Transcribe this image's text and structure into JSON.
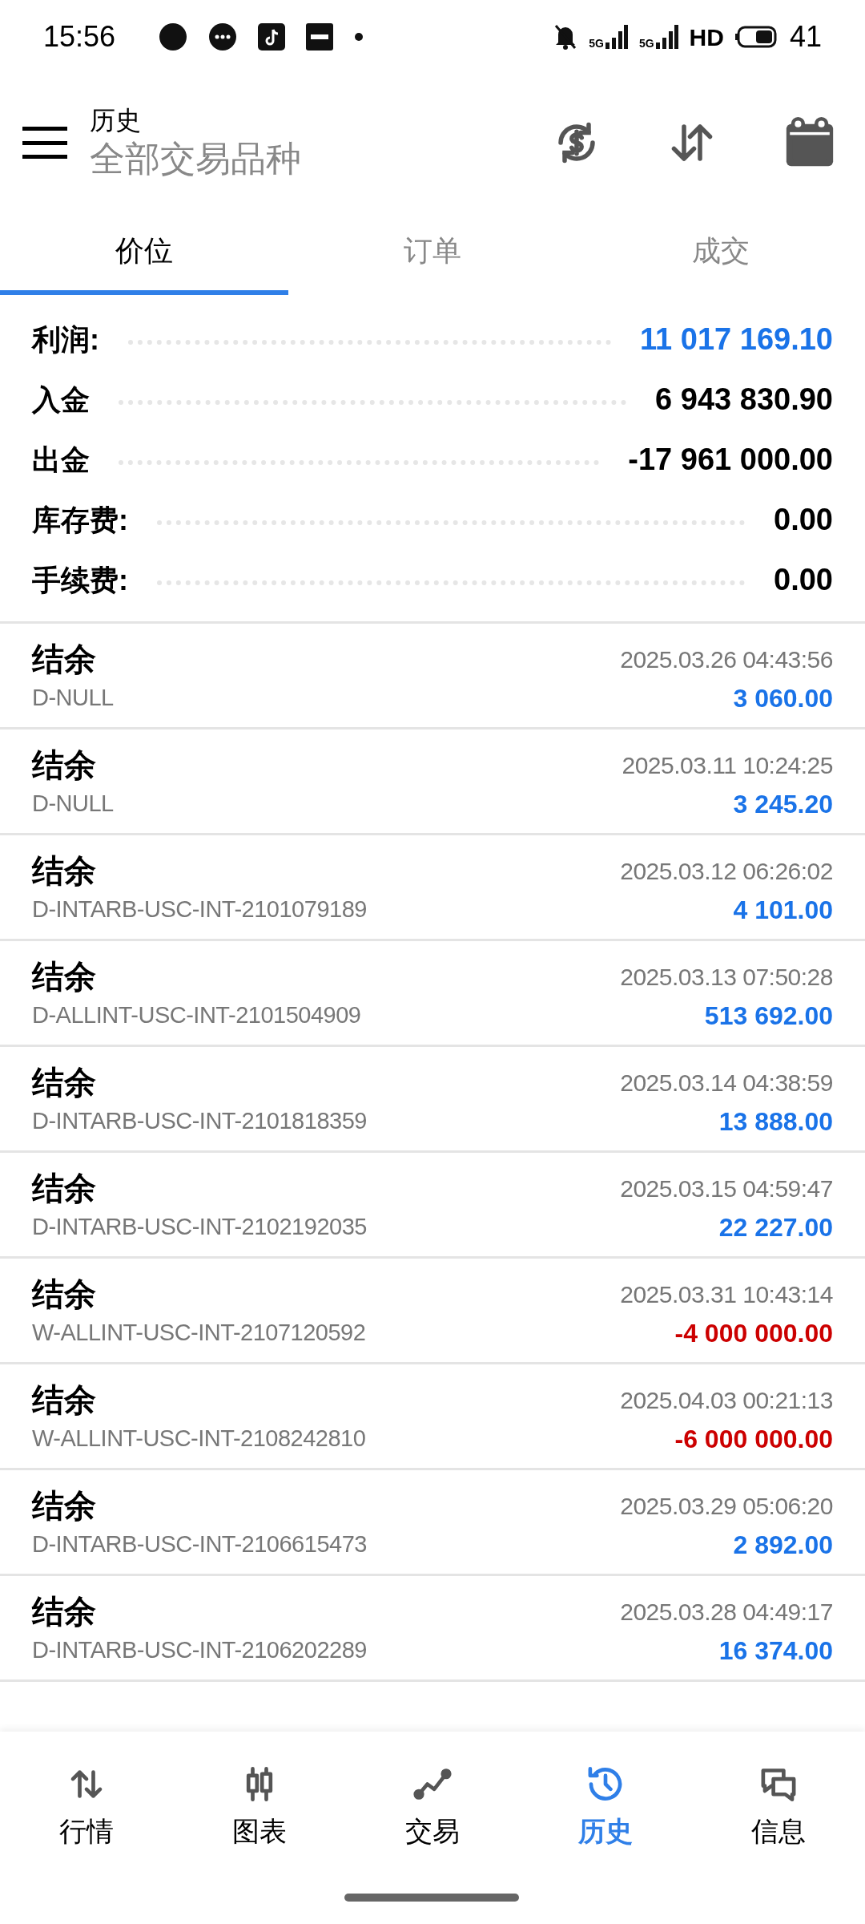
{
  "status_bar": {
    "time": "15:56",
    "network_1": "5G",
    "network_2": "5G",
    "hd": "HD",
    "battery": "41"
  },
  "header": {
    "title": "历史",
    "subtitle": "全部交易品种"
  },
  "tabs": [
    {
      "label": "价位",
      "selected": true
    },
    {
      "label": "订单",
      "selected": false
    },
    {
      "label": "成交",
      "selected": false
    }
  ],
  "summary": [
    {
      "label": "利润:",
      "value": "11 017 169.10",
      "highlight": true
    },
    {
      "label": "入金",
      "value": "6 943 830.90",
      "highlight": false
    },
    {
      "label": "出金",
      "value": "-17 961 000.00",
      "highlight": false
    },
    {
      "label": "库存费:",
      "value": "0.00",
      "highlight": false
    },
    {
      "label": "手续费:",
      "value": "0.00",
      "highlight": false
    }
  ],
  "transactions": [
    {
      "title": "结余",
      "time": "2025.03.26 04:43:56",
      "comment": "D-NULL",
      "amount": "3 060.00",
      "color": "#1a73e8"
    },
    {
      "title": "结余",
      "time": "2025.03.11 10:24:25",
      "comment": "D-NULL",
      "amount": "3 245.20",
      "color": "#1a73e8"
    },
    {
      "title": "结余",
      "time": "2025.03.12 06:26:02",
      "comment": "D-INTARB-USC-INT-2101079189",
      "amount": "4 101.00",
      "color": "#1a73e8"
    },
    {
      "title": "结余",
      "time": "2025.03.13 07:50:28",
      "comment": "D-ALLINT-USC-INT-2101504909",
      "amount": "513 692.00",
      "color": "#1a73e8"
    },
    {
      "title": "结余",
      "time": "2025.03.14 04:38:59",
      "comment": "D-INTARB-USC-INT-2101818359",
      "amount": "13 888.00",
      "color": "#1a73e8"
    },
    {
      "title": "结余",
      "time": "2025.03.15 04:59:47",
      "comment": "D-INTARB-USC-INT-2102192035",
      "amount": "22 227.00",
      "color": "#1a73e8"
    },
    {
      "title": "结余",
      "time": "2025.03.31 10:43:14",
      "comment": "W-ALLINT-USC-INT-2107120592",
      "amount": "-4 000 000.00",
      "color": "#cc0000"
    },
    {
      "title": "结余",
      "time": "2025.04.03 00:21:13",
      "comment": "W-ALLINT-USC-INT-2108242810",
      "amount": "-6 000 000.00",
      "color": "#cc0000"
    },
    {
      "title": "结余",
      "time": "2025.03.29 05:06:20",
      "comment": "D-INTARB-USC-INT-2106615473",
      "amount": "2 892.00",
      "color": "#1a73e8"
    },
    {
      "title": "结余",
      "time": "2025.03.28 04:49:17",
      "comment": "D-INTARB-USC-INT-2106202289",
      "amount": "16 374.00",
      "color": "#1a73e8"
    }
  ],
  "bottom_nav": [
    {
      "label": "行情",
      "kind": "quotes",
      "selected": false
    },
    {
      "label": "图表",
      "kind": "chart",
      "selected": false
    },
    {
      "label": "交易",
      "kind": "trade",
      "selected": false
    },
    {
      "label": "历史",
      "kind": "history",
      "selected": true
    },
    {
      "label": "信息",
      "kind": "messages",
      "selected": false
    }
  ]
}
